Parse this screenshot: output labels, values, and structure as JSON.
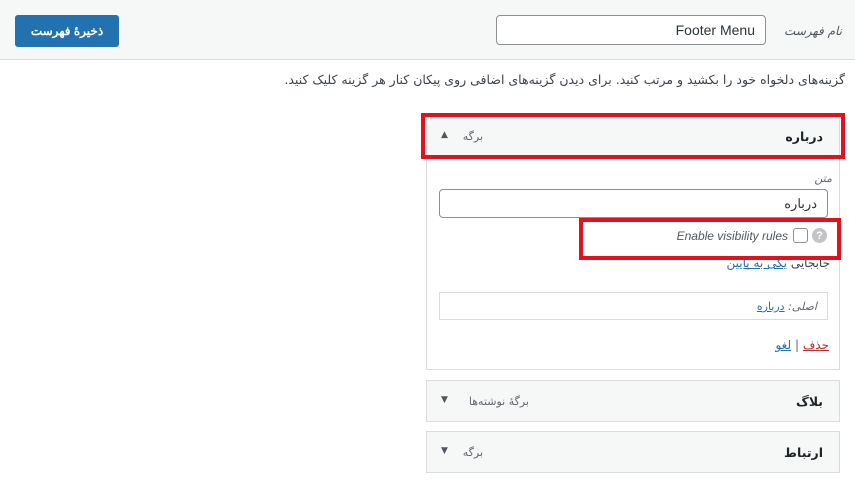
{
  "header": {
    "save_label": "ذخیرهٔ فهرست",
    "menu_name_label": "نام فهرست",
    "menu_name_value": "Footer Menu"
  },
  "instructions": "گزینه‌های دلخواه خود را بکشید و مرتب کنید. برای دیدن گزینه‌های اضافی روی پیکان کنار هر گزینه کلیک کنید.",
  "menu_items": [
    {
      "title": "درباره",
      "type": "برگه",
      "arrow": "▲",
      "expanded": true,
      "settings": {
        "nav_label_caption": "متن",
        "nav_label_value": "درباره",
        "visibility_label": "Enable visibility rules",
        "visibility_checked": false,
        "help_glyph": "?",
        "move_label": "جابجایی",
        "move_link": "یکی به پایین",
        "original_label": "اصلی:",
        "original_link": "درباره",
        "remove_label": "حذف",
        "separator": "|",
        "cancel_label": "لغو"
      }
    },
    {
      "title": "بلاگ",
      "type": "برگهٔ نوشته‌ها",
      "arrow": "▼",
      "expanded": false
    },
    {
      "title": "ارتباط",
      "type": "برگه",
      "arrow": "▼",
      "expanded": false
    }
  ],
  "colors": {
    "primary_button": "#2271b1",
    "highlight_outline": "#e0121e",
    "delete_link": "#b32d2e"
  }
}
